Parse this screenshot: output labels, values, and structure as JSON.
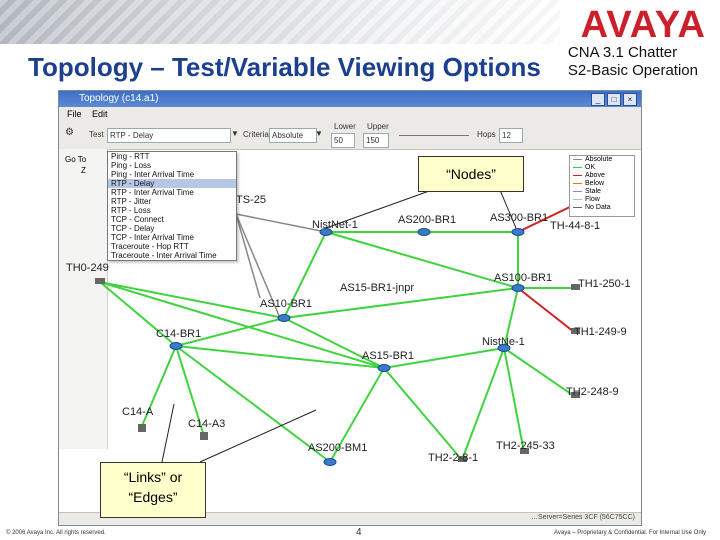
{
  "header": {
    "brand": "AVAYA",
    "title": "Topology – Test/Variable Viewing Options",
    "subtitle_line1": "CNA 3.1 Chatter",
    "subtitle_line2": "S2-Basic Operation"
  },
  "window": {
    "title": "Topology (c14.a1)",
    "menu": [
      "File",
      "Edit"
    ],
    "toolbar": {
      "test_label": "Test",
      "test_value": "RTP - Delay",
      "criteria_label": "Criteria",
      "criteria_value": "Absolute",
      "limits_label": "Lower",
      "lower_value": "50",
      "upper_label": "Upper",
      "upper_value": "150",
      "hops_label": "Hops",
      "hops_value": "12"
    },
    "side": {
      "go_to": "Go To",
      "zoom": "Z"
    },
    "status_text": "…Server=Series 3CF (56C75CC)"
  },
  "dropdown": {
    "items": [
      "Ping - RTT",
      "Ping - Loss",
      "Ping - Inter Arrival Time",
      "RTP - Delay",
      "RTP - Inter Arrival Time",
      "RTP - Jitter",
      "RTP - Loss",
      "TCP - Connect",
      "TCP - Delay",
      "TCP - Inter Arrival Time",
      "Traceroute - Hop RTT",
      "Traceroute - Inter Arrival Time"
    ],
    "selected_index": 3
  },
  "legend": {
    "items": [
      {
        "label": "Absolute",
        "color": "#888888"
      },
      {
        "label": "OK",
        "color": "#3ccd3c"
      },
      {
        "label": "Above",
        "color": "#cc2222"
      },
      {
        "label": "Below",
        "color": "#e07a1a"
      },
      {
        "label": "Stale",
        "color": "#8888cc"
      },
      {
        "label": "Flow",
        "color": "#bbbbbb"
      },
      {
        "label": "No Data",
        "color": "#666666"
      }
    ]
  },
  "nodes": {
    "n_ts25": "TS-25",
    "n_nistnet": "NistNet-1",
    "n_as200br1": "AS200-BR1",
    "n_as300": "AS300-BR1",
    "n_th44": "TH-44-8-1",
    "n_th0": "TH0-249",
    "n_as15_jnpr": "AS15-BR1-jnpr",
    "n_as100": "AS100-BR1",
    "n_th1": "TH1-250-1",
    "n_as10": "AS10-BR1",
    "n_c14": "C14-BR1",
    "n_th1_249": "TH1-249-9",
    "n_as15": "AS15-BR1",
    "n_nistne": "NistNe-1",
    "n_c14a": "C14-A",
    "n_c14a3": "C14-A3",
    "n_th2_248": "TH2-248-9",
    "n_th2_245": "TH2-245-33",
    "n_as200bm1": "AS200-BM1",
    "n_th2_2_8": "TH2-2-8-1"
  },
  "callouts": {
    "nodes": "“Nodes”",
    "links_line1": "“Links” or",
    "links_line2": "“Edges”"
  },
  "footer": {
    "copyright": "© 2006 Avaya Inc. All rights reserved.",
    "page_number": "4",
    "confidential": "Avaya – Proprietary & Confidential. For Internal Use Only"
  }
}
